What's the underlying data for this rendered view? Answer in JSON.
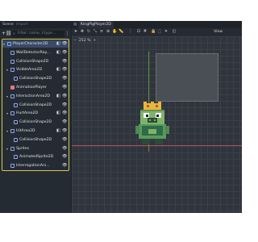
{
  "dock": {
    "tabs": [
      "Scene",
      "Import"
    ],
    "filter_placeholder": "Filter: name, t:type..."
  },
  "tree": [
    {
      "label": "PlayerCharacter2D",
      "icon": "character-body-icon",
      "color": "#8da5f3",
      "depth": 0,
      "toggle": "v",
      "signal": true,
      "selected": true
    },
    {
      "label": "WallDetectorRay...",
      "icon": "raycast-icon",
      "color": "#8da5f3",
      "depth": 1,
      "toggle": "",
      "signal": true
    },
    {
      "label": "CollisionShape2D",
      "icon": "collision-shape-icon",
      "color": "#8da5f3",
      "depth": 1,
      "toggle": "",
      "signal": false
    },
    {
      "label": "VisibleArea2D",
      "icon": "area-icon",
      "color": "#8da5f3",
      "depth": 1,
      "toggle": "v",
      "signal": true
    },
    {
      "label": "CollisionShape2D",
      "icon": "collision-shape-icon",
      "color": "#8da5f3",
      "depth": 2,
      "toggle": "",
      "signal": false
    },
    {
      "label": "AnimationPlayer",
      "icon": "animation-player-icon",
      "color": "#e4758a",
      "depth": 1,
      "toggle": "",
      "signal": false
    },
    {
      "label": "InteractionArea2D",
      "icon": "area-icon",
      "color": "#8da5f3",
      "depth": 1,
      "toggle": "v",
      "signal": true
    },
    {
      "label": "CollisionShape2D",
      "icon": "collision-shape-icon",
      "color": "#8da5f3",
      "depth": 2,
      "toggle": "",
      "signal": false
    },
    {
      "label": "HurtArea2D",
      "icon": "area-icon",
      "color": "#8da5f3",
      "depth": 1,
      "toggle": "v",
      "signal": true
    },
    {
      "label": "CollisionShape2D",
      "icon": "collision-shape-icon",
      "color": "#8da5f3",
      "depth": 2,
      "toggle": "",
      "signal": false
    },
    {
      "label": "HitArea2D",
      "icon": "area-icon",
      "color": "#8da5f3",
      "depth": 1,
      "toggle": "v",
      "signal": true
    },
    {
      "label": "CollisionShape2D",
      "icon": "collision-shape-icon",
      "color": "#8da5f3",
      "depth": 2,
      "toggle": "",
      "signal": false
    },
    {
      "label": "Sprites",
      "icon": "node2d-icon",
      "color": "#8da5f3",
      "depth": 1,
      "toggle": "v",
      "signal": false
    },
    {
      "label": "AnimatedSprite2D",
      "icon": "animated-sprite-icon",
      "color": "#8da5f3",
      "depth": 2,
      "toggle": "",
      "signal": false
    },
    {
      "label": "InterrogationAni...",
      "icon": "animated-sprite-icon",
      "color": "#8da5f3",
      "depth": 1,
      "toggle": "",
      "signal": false
    }
  ],
  "editor": {
    "tab_title": "KingPigPlayer2D",
    "view_label": "View",
    "zoom_label": "252 %"
  },
  "colors": {
    "selection_outline": "#d4c94e",
    "x_axis": "#b34a5a",
    "y_axis": "#5b8e3e",
    "node_icon": "#8da5f3"
  }
}
